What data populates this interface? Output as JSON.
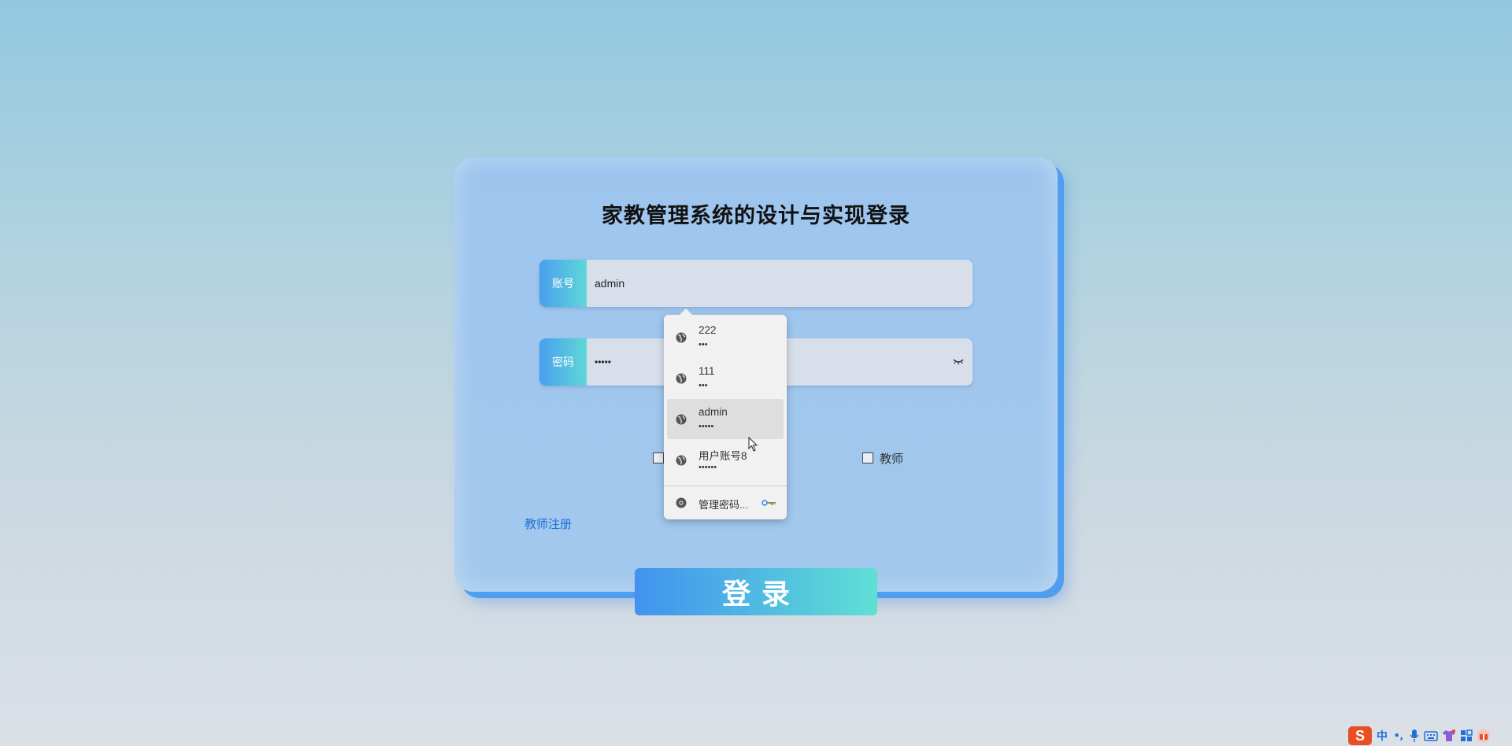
{
  "login": {
    "title": "家教管理系统的设计与实现登录",
    "account_label": "账号",
    "account_value": "admin",
    "password_label": "密码",
    "password_value": "•••••",
    "role_teacher_label": "教师",
    "register_link": "教师注册",
    "login_button": "登录"
  },
  "autofill": {
    "items": [
      {
        "username": "222",
        "password": "•••"
      },
      {
        "username": "111",
        "password": "•••"
      },
      {
        "username": "admin",
        "password": "•••••"
      },
      {
        "username": "用户账号8",
        "password": "••••••"
      }
    ],
    "manage_label": "管理密码..."
  },
  "tray": {
    "ime_logo": "S",
    "ime_mode": "中",
    "punct": "•,",
    "icons": [
      "microphone-icon",
      "keyboard-icon",
      "shirt-icon",
      "grid-icon",
      "gift-icon"
    ]
  },
  "colors": {
    "accent_gradient_start": "#4192ef",
    "accent_gradient_end": "#5fe0d4",
    "link": "#1a6fd6"
  }
}
